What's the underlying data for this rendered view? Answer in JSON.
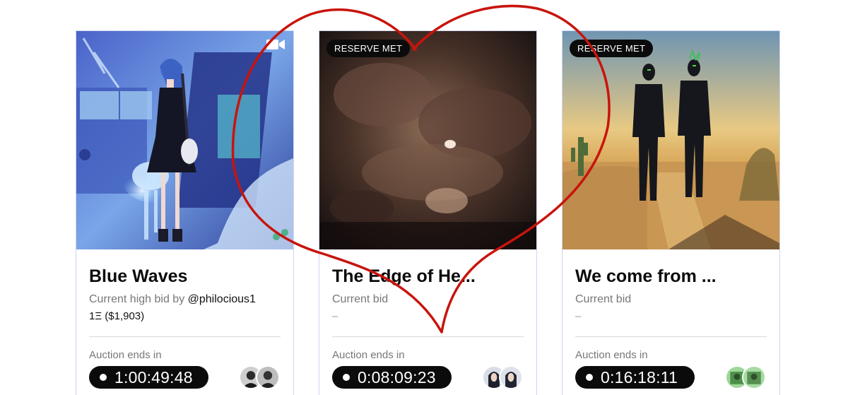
{
  "cards": [
    {
      "title": "Blue Waves",
      "bid_label": "Current high bid by",
      "bidder": "@philocious1",
      "bid_value": "1Ξ ($1,903)",
      "auction_label": "Auction ends in",
      "countdown": "1:00:49:48",
      "media_icon": "video-camera-icon"
    },
    {
      "badge": "RESERVE MET",
      "title": "The Edge of He...",
      "bid_label": "Current bid",
      "bid_value": "–",
      "auction_label": "Auction ends in",
      "countdown": "0:08:09:23"
    },
    {
      "badge": "RESERVE MET",
      "title": "We come from ...",
      "bid_label": "Current bid",
      "bid_value": "–",
      "auction_label": "Auction ends in",
      "countdown": "0:16:18:11"
    }
  ],
  "colors": {
    "card_border": "#cfd6f0",
    "badge_bg": "#0b0b0b",
    "heart_stroke": "#c8140c"
  }
}
